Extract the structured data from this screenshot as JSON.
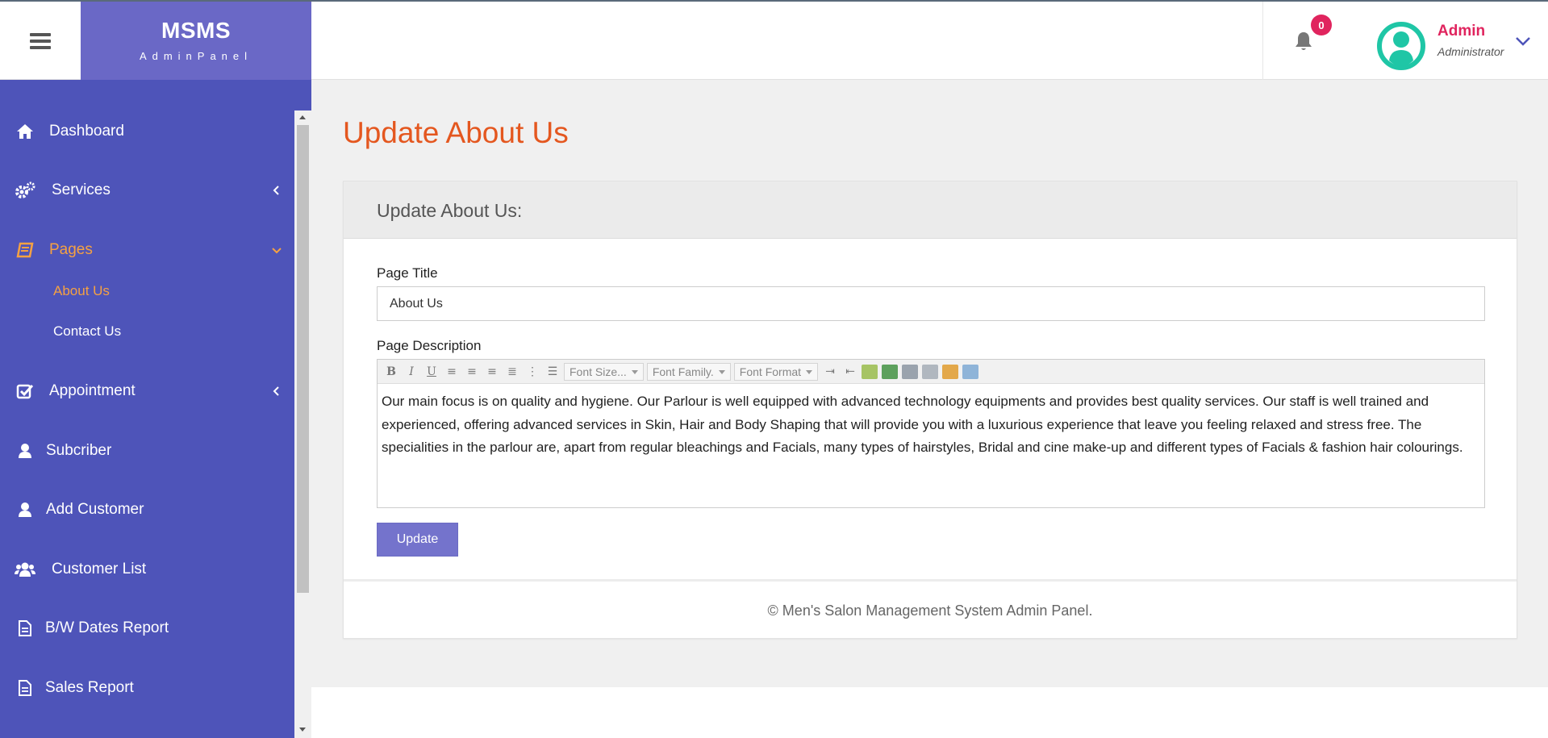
{
  "brand": {
    "name": "MSMS",
    "subtitle": "AdminPanel"
  },
  "header": {
    "notification_count": "0",
    "user_name": "Admin",
    "user_role": "Administrator"
  },
  "sidebar": {
    "items": [
      {
        "label": "Dashboard",
        "icon": "home-icon"
      },
      {
        "label": "Services",
        "icon": "gears-icon"
      },
      {
        "label": "Pages",
        "icon": "book-icon"
      },
      {
        "label": "Appointment",
        "icon": "check-square-icon"
      },
      {
        "label": "Subcriber",
        "icon": "user-icon"
      },
      {
        "label": "Add Customer",
        "icon": "user-icon"
      },
      {
        "label": "Customer List",
        "icon": "users-icon"
      },
      {
        "label": "B/W Dates Report",
        "icon": "file-icon"
      },
      {
        "label": "Sales Report",
        "icon": "file-icon"
      }
    ],
    "pages_sub": [
      {
        "label": "About Us"
      },
      {
        "label": "Contact Us"
      }
    ]
  },
  "main": {
    "title": "Update About Us",
    "panel_title": "Update About Us:",
    "page_title_label": "Page Title",
    "page_title_value": "About Us",
    "page_description_label": "Page Description",
    "toolbar": {
      "font_size": "Font Size...",
      "font_family": "Font Family.",
      "font_format": "Font Format"
    },
    "description_text": "Our main focus is on quality and hygiene. Our Parlour is well equipped with advanced technology equipments and provides best quality services. Our staff is well trained and experienced, offering advanced services in Skin, Hair and Body Shaping that will provide you with a luxurious experience that leave you feeling relaxed and stress free. The specialities in the parlour are, apart from regular bleachings and Facials, many types of hairstyles, Bridal and cine make-up and different types of Facials & fashion hair colourings.",
    "update_button": "Update",
    "footer": "© Men's Salon Management System Admin Panel."
  },
  "colors": {
    "sidebar": "#4e54b9",
    "brand": "#6a68c6",
    "accent": "#e4571f",
    "active_nav": "#f5a142",
    "badge": "#e0245e",
    "button": "#7473cc"
  }
}
